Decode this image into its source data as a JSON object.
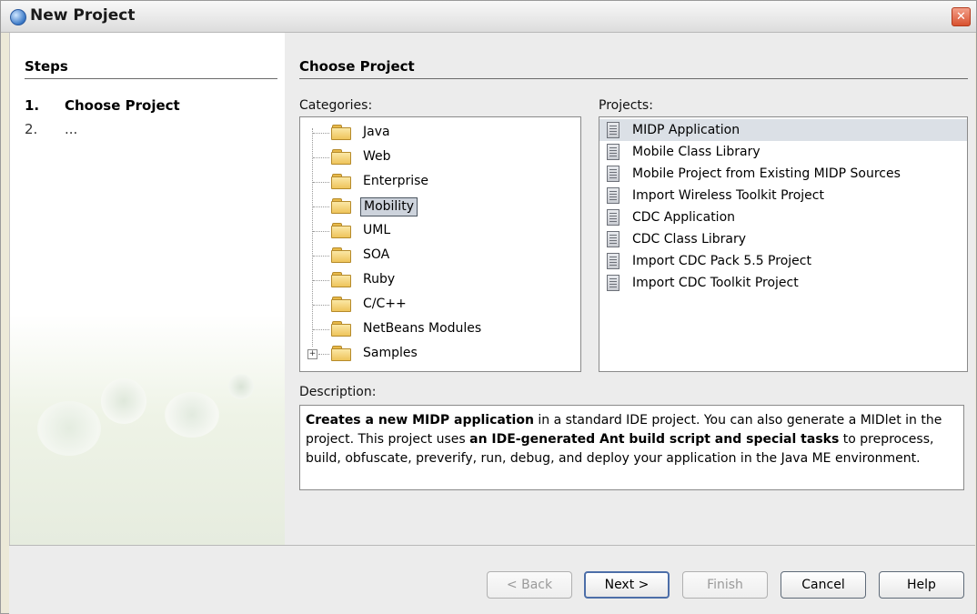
{
  "window": {
    "title": "New Project",
    "close_icon": "close-icon"
  },
  "steps": {
    "heading": "Steps",
    "items": [
      {
        "number": "1.",
        "label": "Choose Project",
        "current": true
      },
      {
        "number": "2.",
        "label": "...",
        "current": false
      }
    ]
  },
  "main": {
    "heading": "Choose Project",
    "categories_label": "Categories:",
    "projects_label": "Projects:",
    "description_label": "Description:"
  },
  "categories": [
    {
      "label": "Java",
      "icon": "folder-icon"
    },
    {
      "label": "Web",
      "icon": "folder-icon"
    },
    {
      "label": "Enterprise",
      "icon": "folder-icon"
    },
    {
      "label": "Mobility",
      "icon": "folder-icon",
      "selected": true
    },
    {
      "label": "UML",
      "icon": "folder-icon"
    },
    {
      "label": "SOA",
      "icon": "folder-icon"
    },
    {
      "label": "Ruby",
      "icon": "folder-icon"
    },
    {
      "label": "C/C++",
      "icon": "folder-icon"
    },
    {
      "label": "NetBeans Modules",
      "icon": "folder-icon"
    },
    {
      "label": "Samples",
      "icon": "folder-icon",
      "expander": "+"
    }
  ],
  "projects": [
    {
      "label": "MIDP Application",
      "selected": true
    },
    {
      "label": "Mobile Class Library"
    },
    {
      "label": "Mobile Project from Existing MIDP Sources"
    },
    {
      "label": "Import Wireless Toolkit Project"
    },
    {
      "label": "CDC Application"
    },
    {
      "label": "CDC Class Library"
    },
    {
      "label": "Import CDC Pack 5.5 Project"
    },
    {
      "label": "Import CDC Toolkit Project"
    }
  ],
  "description": {
    "bold_1": "Creates a new MIDP application",
    "text_1": " in a standard IDE project. You can also generate a MIDlet in the project. This project uses ",
    "bold_2": "an IDE-generated Ant build script and special tasks",
    "text_2": " to preprocess, build, obfuscate, preverify, run, debug, and deploy your application in the Java ME environment."
  },
  "buttons": {
    "back": "< Back",
    "next": "Next >",
    "finish": "Finish",
    "cancel": "Cancel",
    "help": "Help"
  }
}
